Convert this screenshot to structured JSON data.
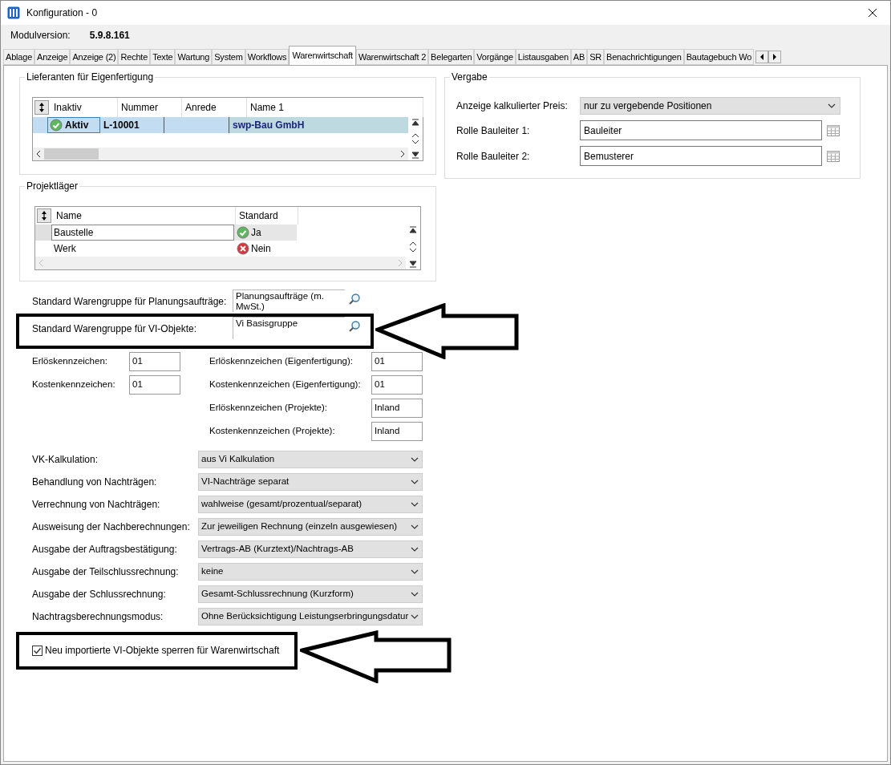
{
  "window": {
    "title": "Konfiguration - 0"
  },
  "module_version": {
    "label": "Modulversion:",
    "value": "5.9.8.161"
  },
  "tabs": [
    {
      "label": "Ablage",
      "selected": false
    },
    {
      "label": "Anzeige",
      "selected": false
    },
    {
      "label": "Anzeige (2)",
      "selected": false
    },
    {
      "label": "Rechte",
      "selected": false
    },
    {
      "label": "Texte",
      "selected": false
    },
    {
      "label": "Wartung",
      "selected": false
    },
    {
      "label": "System",
      "selected": false
    },
    {
      "label": "Workflows",
      "selected": false
    },
    {
      "label": "Warenwirtschaft",
      "selected": true
    },
    {
      "label": "Warenwirtschaft 2",
      "selected": false
    },
    {
      "label": "Belegarten",
      "selected": false
    },
    {
      "label": "Vorgänge",
      "selected": false
    },
    {
      "label": "Listausgaben",
      "selected": false
    },
    {
      "label": "AB",
      "selected": false
    },
    {
      "label": "SR",
      "selected": false
    },
    {
      "label": "Benachrichtigungen",
      "selected": false
    },
    {
      "label": "Bautagebuch Wo",
      "selected": false
    }
  ],
  "suppliers": {
    "title": "Lieferanten für Eigenfertigung",
    "columns": [
      "Inaktiv",
      "Nummer",
      "Anrede",
      "Name 1"
    ],
    "rows": [
      {
        "status": "Aktiv",
        "ok": true,
        "number": "L-10001",
        "name": "swp-Bau GmbH",
        "selected": true
      }
    ]
  },
  "warehouses": {
    "title": "Projektläger",
    "columns": [
      "Name",
      "Standard"
    ],
    "rows": [
      {
        "name": "Baustelle",
        "standard": "Ja",
        "ok": true,
        "selected": true
      },
      {
        "name": "Werk",
        "standard": "Nein",
        "ok": false,
        "selected": false
      }
    ]
  },
  "vergabe": {
    "title": "Vergabe",
    "fields": [
      {
        "kind": "dropdown",
        "label": "Anzeige kalkulierter Preis:",
        "value": "nur zu vergebende Positionen"
      },
      {
        "kind": "lookup",
        "label": "Rolle Bauleiter 1:",
        "value": "Bauleiter"
      },
      {
        "kind": "lookup",
        "label": "Rolle Bauleiter 2:",
        "value": "Bemusterer"
      }
    ]
  },
  "product_groups": [
    {
      "label": "Standard Warengruppe für Planungsaufträge:",
      "value": "Planungsaufträge (m. MwSt.)"
    },
    {
      "label": "Standard Warengruppe für VI-Objekte:",
      "value": "Vi Basisgruppe"
    }
  ],
  "codes_left": [
    {
      "label": "Erlöskennzeichen:",
      "value": "01"
    },
    {
      "label": "Kostenkennzeichen:",
      "value": "01"
    }
  ],
  "codes_right": [
    {
      "label": "Erlöskennzeichen (Eigenfertigung):",
      "value": "01"
    },
    {
      "label": "Kostenkennzeichen (Eigenfertigung):",
      "value": "01"
    },
    {
      "label": "Erlöskennzeichen (Projekte):",
      "value": "Inland"
    },
    {
      "label": "Kostenkennzeichen (Projekte):",
      "value": "Inland"
    }
  ],
  "dropdowns": [
    {
      "label": "VK-Kalkulation:",
      "value": "aus Vi Kalkulation"
    },
    {
      "label": "Behandlung von Nachträgen:",
      "value": "VI-Nachträge separat"
    },
    {
      "label": "Verrechnung von Nachträgen:",
      "value": "wahlweise (gesamt/prozentual/separat)"
    },
    {
      "label": "Ausweisung der Nachberechnungen:",
      "value": "Zur jeweiligen Rechnung (einzeln ausgewiesen)"
    },
    {
      "label": "Ausgabe der Auftragsbestätigung:",
      "value": "Vertrags-AB (Kurztext)/Nachtrags-AB"
    },
    {
      "label": "Ausgabe der Teilschlussrechnung:",
      "value": "keine"
    },
    {
      "label": "Ausgabe der Schlussrechnung:",
      "value": "Gesamt-Schlussrechnung (Kurzform)"
    },
    {
      "label": "Nachtragsberechnungsmodus:",
      "value": "Ohne Berücksichtigung Leistungserbringungsdatur"
    }
  ],
  "lock_checkbox": {
    "label": "Neu importierte VI-Objekte sperren für Warenwirtschaft",
    "checked": true
  }
}
